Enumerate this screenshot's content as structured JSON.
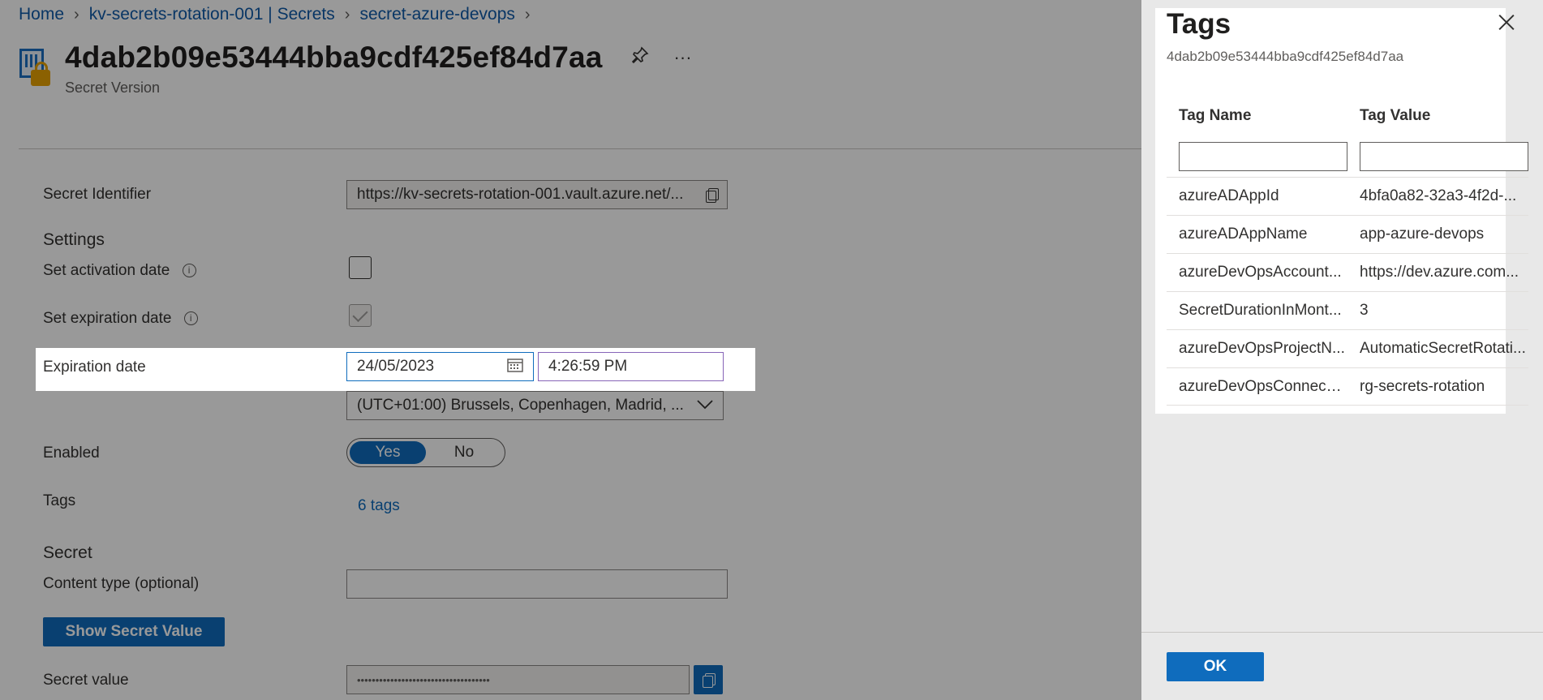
{
  "breadcrumb": {
    "items": [
      "Home",
      "kv-secrets-rotation-001 | Secrets",
      "secret-azure-devops"
    ]
  },
  "header": {
    "title": "4dab2b09e53444bba9cdf425ef84d7aa",
    "subtitle": "Secret Version",
    "pin_icon": "pin-icon",
    "more_icon": "more-icon"
  },
  "form": {
    "secret_identifier_label": "Secret Identifier",
    "secret_identifier_value": "https://kv-secrets-rotation-001.vault.azure.net/...",
    "settings_label": "Settings",
    "activation_label": "Set activation date",
    "activation_checked": false,
    "expiration_label": "Set expiration date",
    "expiration_checked": true,
    "expiration_date_label": "Expiration date",
    "expiration_date_value": "24/05/2023",
    "expiration_time_value": "4:26:59 PM",
    "timezone_value": "(UTC+01:00) Brussels, Copenhagen, Madrid, ...",
    "enabled_label": "Enabled",
    "enabled_yes": "Yes",
    "enabled_no": "No",
    "enabled_selected": "Yes",
    "tags_label": "Tags",
    "tags_link": "6 tags",
    "secret_section_label": "Secret",
    "content_type_label": "Content type (optional)",
    "content_type_value": "",
    "show_secret_button": "Show Secret Value",
    "secret_value_label": "Secret value",
    "secret_value_masked": "••••••••••••••••••••••••••••••••••••"
  },
  "tags_dialog": {
    "title": "Tags",
    "subtitle": "4dab2b09e53444bba9cdf425ef84d7aa",
    "col_name": "Tag Name",
    "col_value": "Tag Value",
    "rows": [
      {
        "name": "azureADAppId",
        "value": "4bfa0a82-32a3-4f2d-..."
      },
      {
        "name": "azureADAppName",
        "value": "app-azure-devops"
      },
      {
        "name": "azureDevOpsAccount...",
        "value": "https://dev.azure.com..."
      },
      {
        "name": "SecretDurationInMont...",
        "value": "3"
      },
      {
        "name": "azureDevOpsProjectN...",
        "value": "AutomaticSecretRotati..."
      },
      {
        "name": "azureDevOpsConnecti...",
        "value": "rg-secrets-rotation"
      }
    ],
    "ok_button": "OK"
  },
  "colors": {
    "accent": "#0f6cbd",
    "time_border": "#8764b8"
  }
}
